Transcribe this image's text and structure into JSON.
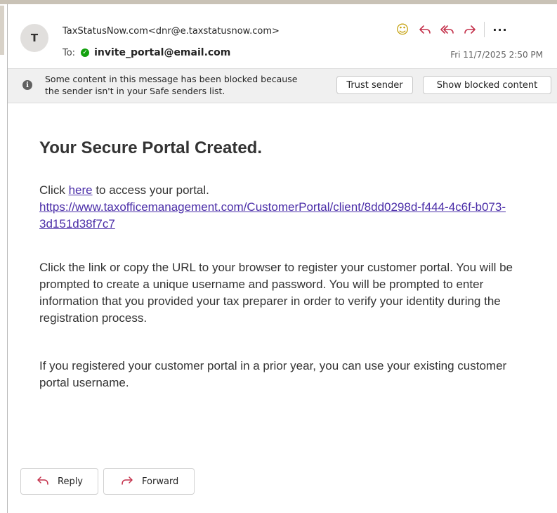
{
  "message": {
    "sender_initial": "T",
    "from": "TaxStatusNow.com<dnr@e.taxstatusnow.com>",
    "to_label": "To:",
    "to_email": "invite_portal@email.com",
    "date": "Fri 11/7/2025 2:50 PM"
  },
  "banner": {
    "text": "Some content in this message has been blocked because the sender isn't in your Safe senders list.",
    "trust_label": "Trust sender",
    "show_label": "Show blocked content"
  },
  "body": {
    "title": "Your Secure Portal Created.",
    "click_prefix": "Click ",
    "here": "here",
    "click_suffix": " to access your portal.",
    "url": "https://www.taxofficemanagement.com/CustomerPortal/client/8dd0298d-f444-4c6f-b073-3d151d38f7c7",
    "para2": "Click the link or copy the URL to your browser to register your customer portal. You will be prompted to create a unique username and password. You will be prompted to enter information that you provided your tax preparer in order to verify your identity during the registration process.",
    "para3": "If you registered your customer portal in a prior year, you can use your existing customer portal username."
  },
  "footer": {
    "reply_label": "Reply",
    "forward_label": "Forward"
  },
  "icons": {
    "emoji": "smiley-icon",
    "reply": "reply-icon",
    "reply_all": "reply-all-icon",
    "forward": "forward-icon",
    "more": "more-icon",
    "verified": "check-circle-icon",
    "info": "info-icon"
  },
  "colors": {
    "accent_red": "#c4314b",
    "link": "#4b2ea8",
    "verified_green": "#13a10e"
  }
}
